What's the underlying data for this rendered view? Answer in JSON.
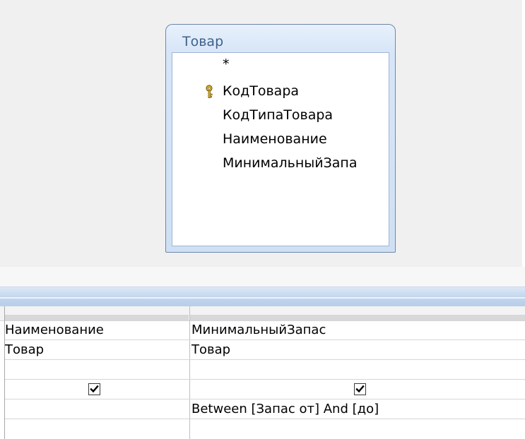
{
  "table": {
    "title": "Товар",
    "fields": [
      {
        "label": "*",
        "primary_key": false
      },
      {
        "label": "КодТовара",
        "primary_key": true,
        "icon": "key-icon"
      },
      {
        "label": "КодТипаТовара",
        "primary_key": false
      },
      {
        "label": "Наименование",
        "primary_key": false
      },
      {
        "label": "МинимальныйЗапа",
        "primary_key": false
      }
    ]
  },
  "grid": {
    "columns": [
      {
        "field": "Наименование",
        "table": "Товар",
        "sort": "",
        "show": true,
        "criteria": ""
      },
      {
        "field": "МинимальныйЗапас",
        "table": "Товар",
        "sort": "",
        "show": true,
        "criteria": "Between [Запас от] And [до]"
      }
    ]
  },
  "colors": {
    "table_border": "#6e87a9",
    "table_title": "#3f618a",
    "splitter": "#c2d6ee",
    "key_icon": "#d4a017"
  }
}
